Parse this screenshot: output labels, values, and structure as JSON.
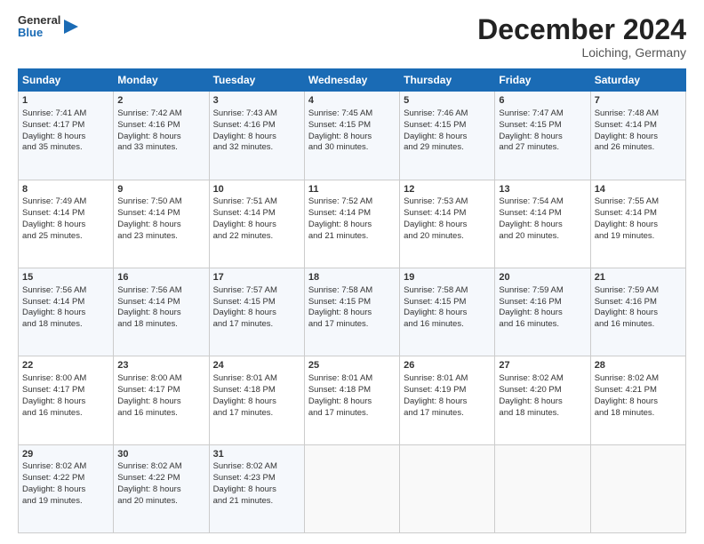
{
  "logo": {
    "line1": "General",
    "line2": "Blue"
  },
  "title": "December 2024",
  "subtitle": "Loiching, Germany",
  "days_header": [
    "Sunday",
    "Monday",
    "Tuesday",
    "Wednesday",
    "Thursday",
    "Friday",
    "Saturday"
  ],
  "weeks": [
    [
      {
        "day": "1",
        "lines": [
          "Sunrise: 7:41 AM",
          "Sunset: 4:17 PM",
          "Daylight: 8 hours",
          "and 35 minutes."
        ]
      },
      {
        "day": "2",
        "lines": [
          "Sunrise: 7:42 AM",
          "Sunset: 4:16 PM",
          "Daylight: 8 hours",
          "and 33 minutes."
        ]
      },
      {
        "day": "3",
        "lines": [
          "Sunrise: 7:43 AM",
          "Sunset: 4:16 PM",
          "Daylight: 8 hours",
          "and 32 minutes."
        ]
      },
      {
        "day": "4",
        "lines": [
          "Sunrise: 7:45 AM",
          "Sunset: 4:15 PM",
          "Daylight: 8 hours",
          "and 30 minutes."
        ]
      },
      {
        "day": "5",
        "lines": [
          "Sunrise: 7:46 AM",
          "Sunset: 4:15 PM",
          "Daylight: 8 hours",
          "and 29 minutes."
        ]
      },
      {
        "day": "6",
        "lines": [
          "Sunrise: 7:47 AM",
          "Sunset: 4:15 PM",
          "Daylight: 8 hours",
          "and 27 minutes."
        ]
      },
      {
        "day": "7",
        "lines": [
          "Sunrise: 7:48 AM",
          "Sunset: 4:14 PM",
          "Daylight: 8 hours",
          "and 26 minutes."
        ]
      }
    ],
    [
      {
        "day": "8",
        "lines": [
          "Sunrise: 7:49 AM",
          "Sunset: 4:14 PM",
          "Daylight: 8 hours",
          "and 25 minutes."
        ]
      },
      {
        "day": "9",
        "lines": [
          "Sunrise: 7:50 AM",
          "Sunset: 4:14 PM",
          "Daylight: 8 hours",
          "and 23 minutes."
        ]
      },
      {
        "day": "10",
        "lines": [
          "Sunrise: 7:51 AM",
          "Sunset: 4:14 PM",
          "Daylight: 8 hours",
          "and 22 minutes."
        ]
      },
      {
        "day": "11",
        "lines": [
          "Sunrise: 7:52 AM",
          "Sunset: 4:14 PM",
          "Daylight: 8 hours",
          "and 21 minutes."
        ]
      },
      {
        "day": "12",
        "lines": [
          "Sunrise: 7:53 AM",
          "Sunset: 4:14 PM",
          "Daylight: 8 hours",
          "and 20 minutes."
        ]
      },
      {
        "day": "13",
        "lines": [
          "Sunrise: 7:54 AM",
          "Sunset: 4:14 PM",
          "Daylight: 8 hours",
          "and 20 minutes."
        ]
      },
      {
        "day": "14",
        "lines": [
          "Sunrise: 7:55 AM",
          "Sunset: 4:14 PM",
          "Daylight: 8 hours",
          "and 19 minutes."
        ]
      }
    ],
    [
      {
        "day": "15",
        "lines": [
          "Sunrise: 7:56 AM",
          "Sunset: 4:14 PM",
          "Daylight: 8 hours",
          "and 18 minutes."
        ]
      },
      {
        "day": "16",
        "lines": [
          "Sunrise: 7:56 AM",
          "Sunset: 4:14 PM",
          "Daylight: 8 hours",
          "and 18 minutes."
        ]
      },
      {
        "day": "17",
        "lines": [
          "Sunrise: 7:57 AM",
          "Sunset: 4:15 PM",
          "Daylight: 8 hours",
          "and 17 minutes."
        ]
      },
      {
        "day": "18",
        "lines": [
          "Sunrise: 7:58 AM",
          "Sunset: 4:15 PM",
          "Daylight: 8 hours",
          "and 17 minutes."
        ]
      },
      {
        "day": "19",
        "lines": [
          "Sunrise: 7:58 AM",
          "Sunset: 4:15 PM",
          "Daylight: 8 hours",
          "and 16 minutes."
        ]
      },
      {
        "day": "20",
        "lines": [
          "Sunrise: 7:59 AM",
          "Sunset: 4:16 PM",
          "Daylight: 8 hours",
          "and 16 minutes."
        ]
      },
      {
        "day": "21",
        "lines": [
          "Sunrise: 7:59 AM",
          "Sunset: 4:16 PM",
          "Daylight: 8 hours",
          "and 16 minutes."
        ]
      }
    ],
    [
      {
        "day": "22",
        "lines": [
          "Sunrise: 8:00 AM",
          "Sunset: 4:17 PM",
          "Daylight: 8 hours",
          "and 16 minutes."
        ]
      },
      {
        "day": "23",
        "lines": [
          "Sunrise: 8:00 AM",
          "Sunset: 4:17 PM",
          "Daylight: 8 hours",
          "and 16 minutes."
        ]
      },
      {
        "day": "24",
        "lines": [
          "Sunrise: 8:01 AM",
          "Sunset: 4:18 PM",
          "Daylight: 8 hours",
          "and 17 minutes."
        ]
      },
      {
        "day": "25",
        "lines": [
          "Sunrise: 8:01 AM",
          "Sunset: 4:18 PM",
          "Daylight: 8 hours",
          "and 17 minutes."
        ]
      },
      {
        "day": "26",
        "lines": [
          "Sunrise: 8:01 AM",
          "Sunset: 4:19 PM",
          "Daylight: 8 hours",
          "and 17 minutes."
        ]
      },
      {
        "day": "27",
        "lines": [
          "Sunrise: 8:02 AM",
          "Sunset: 4:20 PM",
          "Daylight: 8 hours",
          "and 18 minutes."
        ]
      },
      {
        "day": "28",
        "lines": [
          "Sunrise: 8:02 AM",
          "Sunset: 4:21 PM",
          "Daylight: 8 hours",
          "and 18 minutes."
        ]
      }
    ],
    [
      {
        "day": "29",
        "lines": [
          "Sunrise: 8:02 AM",
          "Sunset: 4:22 PM",
          "Daylight: 8 hours",
          "and 19 minutes."
        ]
      },
      {
        "day": "30",
        "lines": [
          "Sunrise: 8:02 AM",
          "Sunset: 4:22 PM",
          "Daylight: 8 hours",
          "and 20 minutes."
        ]
      },
      {
        "day": "31",
        "lines": [
          "Sunrise: 8:02 AM",
          "Sunset: 4:23 PM",
          "Daylight: 8 hours",
          "and 21 minutes."
        ]
      },
      {
        "day": "",
        "lines": []
      },
      {
        "day": "",
        "lines": []
      },
      {
        "day": "",
        "lines": []
      },
      {
        "day": "",
        "lines": []
      }
    ]
  ]
}
